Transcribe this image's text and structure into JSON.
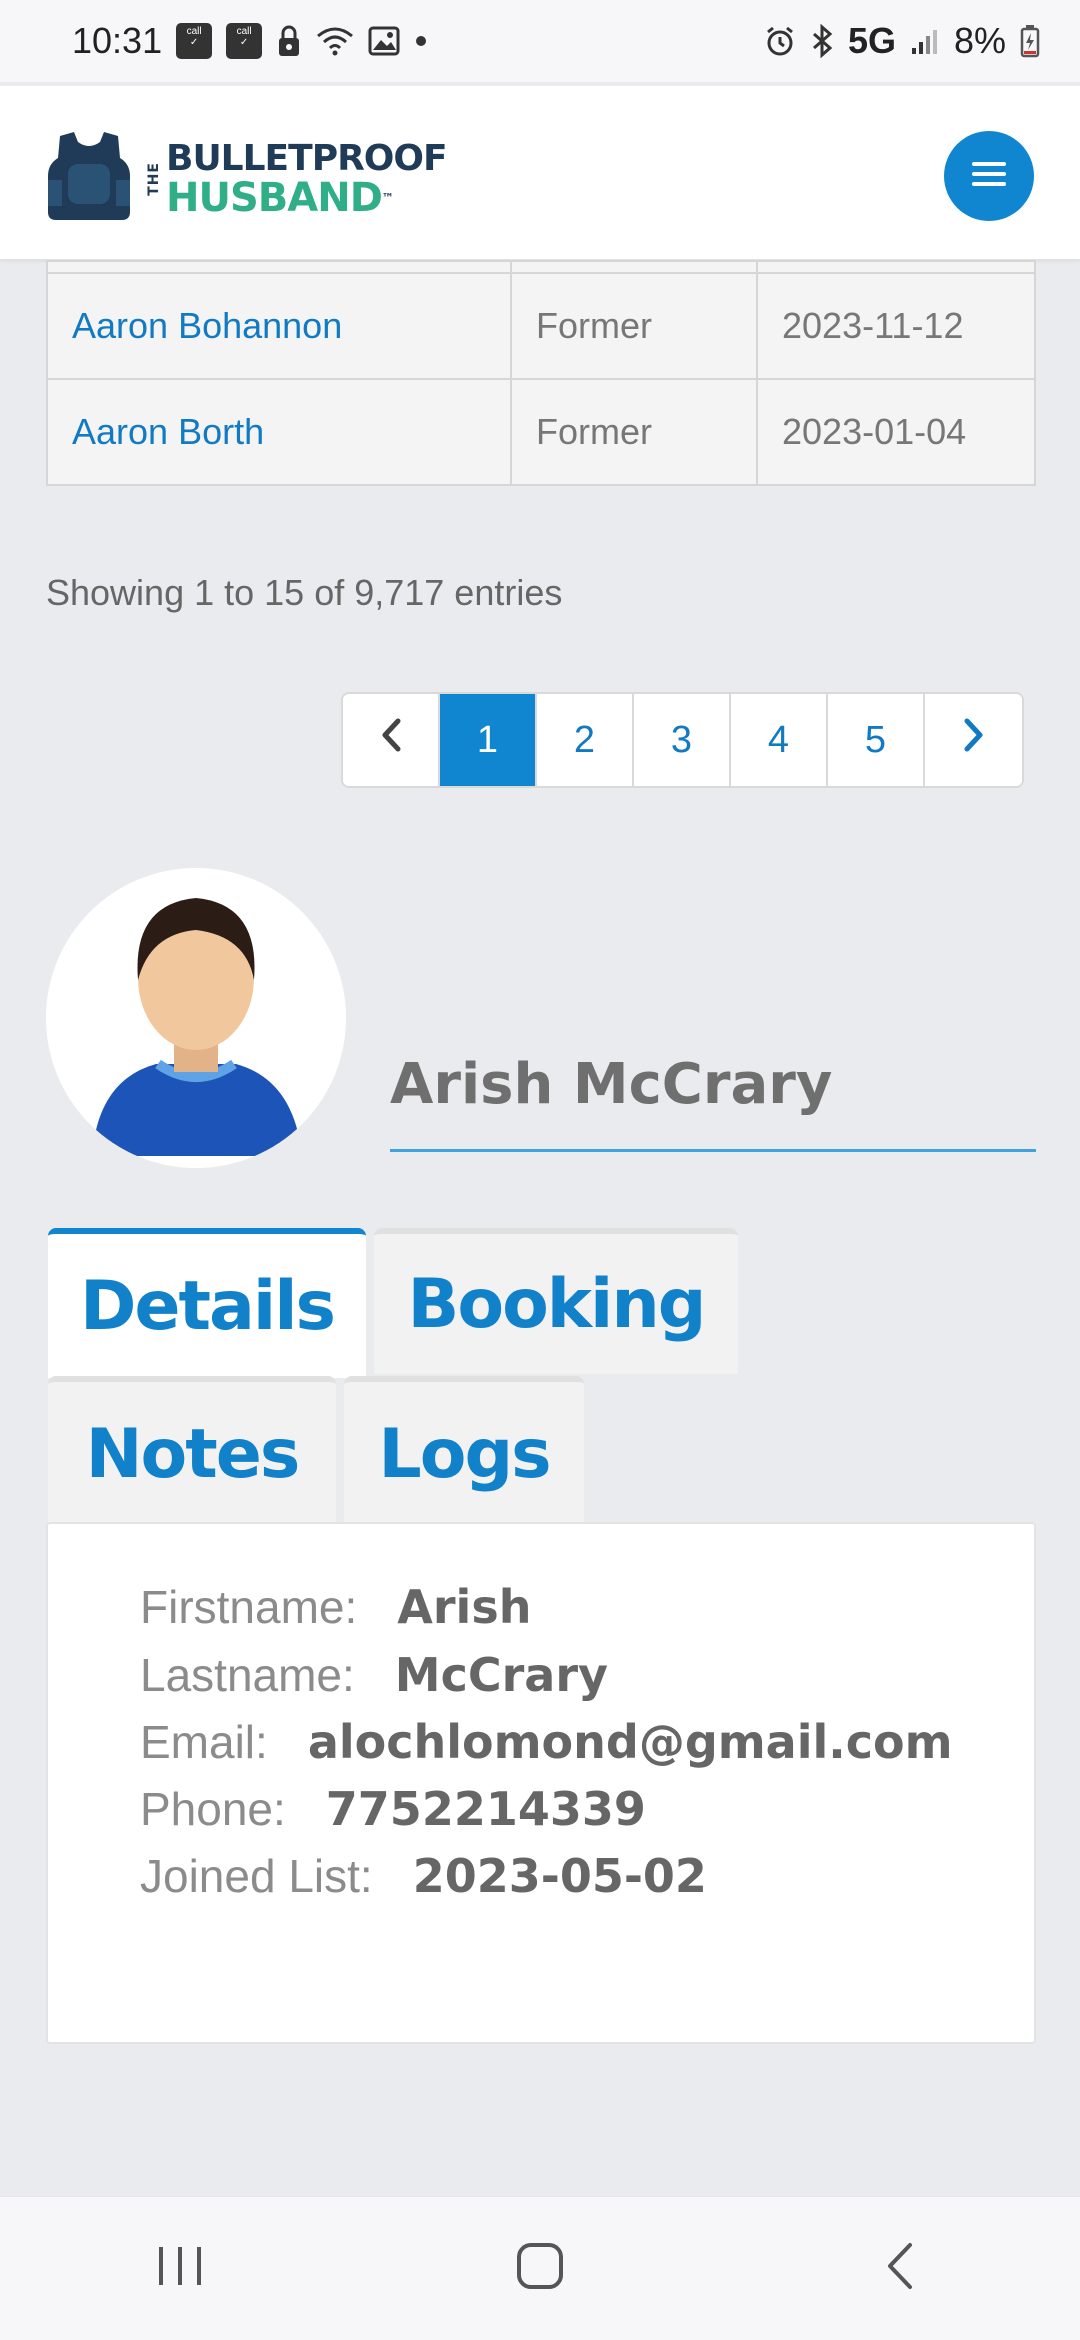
{
  "status_bar": {
    "time": "10:31",
    "network": "5G",
    "battery": "8%",
    "icons": [
      "call-filter-icon",
      "call-filter-icon",
      "lock-icon",
      "wifi-icon",
      "image-icon",
      "dot-icon",
      "alarm-icon",
      "bluetooth-icon",
      "signal-icon",
      "battery-icon"
    ]
  },
  "header": {
    "logo_line1": "BULLETPROOF",
    "logo_the": "THE",
    "logo_line2": "HUSBAND",
    "logo_tm": "™",
    "menu_icon": "hamburger-icon"
  },
  "table": {
    "rows": [
      {
        "name": "Aaron Bohannon",
        "status": "Former",
        "date": "2023-11-12"
      },
      {
        "name": "Aaron Borth",
        "status": "Former",
        "date": "2023-01-04"
      }
    ]
  },
  "entries_info": "Showing 1 to 15 of 9,717 entries",
  "pagination": {
    "prev": "‹",
    "pages": [
      "1",
      "2",
      "3",
      "4",
      "5"
    ],
    "active": "1",
    "next": "›"
  },
  "profile": {
    "name": "Arish McCrary"
  },
  "tabs": {
    "details": "Details",
    "booking": "Booking",
    "notes": "Notes",
    "logs": "Logs",
    "active": "Details"
  },
  "details": {
    "firstname_label": "Firstname:",
    "firstname": "Arish",
    "lastname_label": "Lastname:",
    "lastname": "McCrary",
    "email_label": "Email:",
    "email": "alochlomond@gmail.com",
    "phone_label": "Phone:",
    "phone": "7752214339",
    "joined_label": "Joined List:",
    "joined": "2023-05-02"
  },
  "colors": {
    "accent": "#0f86cf",
    "link": "#127ac2",
    "brand_dark": "#1f3b57",
    "brand_green": "#2fae88"
  }
}
